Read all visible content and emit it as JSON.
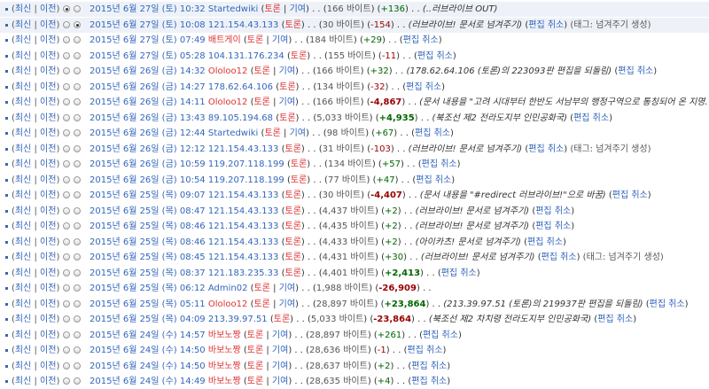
{
  "ui": {
    "cur": "최신",
    "prev": "이전",
    "undo": "편집 취소",
    "talk": "토론",
    "contribs": "기여",
    "bytes_unit": "바이트"
  },
  "rows": [
    {
      "date": "2015년 6월 27일 (토) 10:32",
      "user": "Startedwiki",
      "user_red": false,
      "contribs": true,
      "size": "166",
      "diff": "+136",
      "sign": "pos",
      "big": false,
      "comment": "(..러브라이브 OUT)",
      "undo": false,
      "tag": "",
      "sel": true,
      "r1": true,
      "r2": false
    },
    {
      "date": "2015년 6월 27일 (토) 10:08",
      "user": "121.154.43.133",
      "user_red": false,
      "contribs": false,
      "size": "30",
      "diff": "-154",
      "sign": "neg",
      "big": false,
      "comment": "(러브라이브! 문서로 넘겨주기)",
      "undo": true,
      "tag": "(태그: 넘겨주기 생성)",
      "sel": true,
      "r1": false,
      "r2": true
    },
    {
      "date": "2015년 6월 27일 (토) 07:49",
      "user": "배트게이",
      "user_red": true,
      "contribs": true,
      "size": "184",
      "diff": "+29",
      "sign": "pos",
      "big": false,
      "comment": "",
      "undo": true,
      "tag": "",
      "sel": false,
      "r1": false,
      "r2": false
    },
    {
      "date": "2015년 6월 27일 (토) 05:28",
      "user": "104.131.176.234",
      "user_red": false,
      "contribs": false,
      "size": "155",
      "diff": "-11",
      "sign": "neg",
      "big": false,
      "comment": "",
      "undo": true,
      "tag": "",
      "sel": false,
      "r1": false,
      "r2": false
    },
    {
      "date": "2015년 6월 26일 (금) 14:32",
      "user": "Ololoo12",
      "user_red": true,
      "contribs": true,
      "size": "166",
      "diff": "+32",
      "sign": "pos",
      "big": false,
      "comment": "(178.62.64.106 (토론)의 223093판 편집을 되돌림)",
      "undo": true,
      "tag": "",
      "sel": false,
      "r1": false,
      "r2": false
    },
    {
      "date": "2015년 6월 26일 (금) 14:27",
      "user": "178.62.64.106",
      "user_red": false,
      "contribs": false,
      "size": "134",
      "diff": "-32",
      "sign": "neg",
      "big": false,
      "comment": "",
      "undo": true,
      "tag": "",
      "sel": false,
      "r1": false,
      "r2": false
    },
    {
      "date": "2015년 6월 26일 (금) 14:11",
      "user": "Ololoo12",
      "user_red": true,
      "contribs": true,
      "size": "166",
      "diff": "-4,867",
      "sign": "neg",
      "big": true,
      "comment": "(문서 내용을 \"고려 시대부터 한반도 서남부의 행정구역으로 통칭되어 온 지명. 전라(全羅)",
      "undo": false,
      "tag": "",
      "sel": false,
      "r1": false,
      "r2": false
    },
    {
      "date": "2015년 6월 26일 (금) 13:43",
      "user": "89.105.194.68",
      "user_red": false,
      "contribs": false,
      "size": "5,033",
      "diff": "+4,935",
      "sign": "pos",
      "big": true,
      "comment": "(북조선 제2 전라도지부 인민공화국)",
      "undo": true,
      "tag": "",
      "sel": false,
      "r1": false,
      "r2": false
    },
    {
      "date": "2015년 6월 26일 (금) 12:44",
      "user": "Startedwiki",
      "user_red": false,
      "contribs": true,
      "size": "98",
      "diff": "+67",
      "sign": "pos",
      "big": false,
      "comment": "",
      "undo": true,
      "tag": "",
      "sel": false,
      "r1": false,
      "r2": false
    },
    {
      "date": "2015년 6월 26일 (금) 12:12",
      "user": "121.154.43.133",
      "user_red": false,
      "contribs": false,
      "size": "31",
      "diff": "-103",
      "sign": "neg",
      "big": false,
      "comment": "(러브라이브! 문서로 넘겨주기)",
      "undo": true,
      "tag": "(태그: 넘겨주기 생성)",
      "sel": false,
      "r1": false,
      "r2": false
    },
    {
      "date": "2015년 6월 26일 (금) 10:59",
      "user": "119.207.118.199",
      "user_red": false,
      "contribs": false,
      "size": "134",
      "diff": "+57",
      "sign": "pos",
      "big": false,
      "comment": "",
      "undo": true,
      "tag": "",
      "sel": false,
      "r1": false,
      "r2": false
    },
    {
      "date": "2015년 6월 26일 (금) 10:54",
      "user": "119.207.118.199",
      "user_red": false,
      "contribs": false,
      "size": "77",
      "diff": "+47",
      "sign": "pos",
      "big": false,
      "comment": "",
      "undo": true,
      "tag": "",
      "sel": false,
      "r1": false,
      "r2": false
    },
    {
      "date": "2015년 6월 25일 (목) 09:07",
      "user": "121.154.43.133",
      "user_red": false,
      "contribs": false,
      "size": "30",
      "diff": "-4,407",
      "sign": "neg",
      "big": true,
      "comment": "(문서 내용을 \"#redirect 러브라이브!\"으로 바꿈)",
      "undo": true,
      "tag": "",
      "sel": false,
      "r1": false,
      "r2": false
    },
    {
      "date": "2015년 6월 25일 (목) 08:47",
      "user": "121.154.43.133",
      "user_red": false,
      "contribs": false,
      "size": "4,437",
      "diff": "+2",
      "sign": "pos",
      "big": false,
      "comment": "(러브라이브! 문서로 넘겨주기)",
      "undo": true,
      "tag": "",
      "sel": false,
      "r1": false,
      "r2": false
    },
    {
      "date": "2015년 6월 25일 (목) 08:46",
      "user": "121.154.43.133",
      "user_red": false,
      "contribs": false,
      "size": "4,435",
      "diff": "+2",
      "sign": "pos",
      "big": false,
      "comment": "(러브라이브! 문서로 넘겨주기)",
      "undo": true,
      "tag": "",
      "sel": false,
      "r1": false,
      "r2": false
    },
    {
      "date": "2015년 6월 25일 (목) 08:46",
      "user": "121.154.43.133",
      "user_red": false,
      "contribs": false,
      "size": "4,433",
      "diff": "+2",
      "sign": "pos",
      "big": false,
      "comment": "(아이카츠! 문서로 넘겨주기)",
      "undo": true,
      "tag": "",
      "sel": false,
      "r1": false,
      "r2": false
    },
    {
      "date": "2015년 6월 25일 (목) 08:45",
      "user": "121.154.43.133",
      "user_red": false,
      "contribs": false,
      "size": "4,431",
      "diff": "+30",
      "sign": "pos",
      "big": false,
      "comment": "(러브라이브! 문서로 넘겨주기)",
      "undo": true,
      "tag": "(태그: 넘겨주기 생성)",
      "sel": false,
      "r1": false,
      "r2": false
    },
    {
      "date": "2015년 6월 25일 (목) 08:37",
      "user": "121.183.235.33",
      "user_red": false,
      "contribs": false,
      "size": "4,401",
      "diff": "+2,413",
      "sign": "pos",
      "big": true,
      "comment": "",
      "undo": true,
      "tag": "",
      "sel": false,
      "r1": false,
      "r2": false
    },
    {
      "date": "2015년 6월 25일 (목) 06:12",
      "user": "Admin02",
      "user_red": false,
      "contribs": true,
      "size": "1,988",
      "diff": "-26,909",
      "sign": "neg",
      "big": true,
      "comment": "",
      "undo": false,
      "tag": "",
      "sel": false,
      "r1": false,
      "r2": false
    },
    {
      "date": "2015년 6월 25일 (목) 05:11",
      "user": "Ololoo12",
      "user_red": true,
      "contribs": true,
      "size": "28,897",
      "diff": "+23,864",
      "sign": "pos",
      "big": true,
      "comment": "(213.39.97.51 (토론)의 219937판 편집을 되돌림)",
      "undo": true,
      "tag": "",
      "sel": false,
      "r1": false,
      "r2": false
    },
    {
      "date": "2015년 6월 25일 (목) 04:09",
      "user": "213.39.97.51",
      "user_red": false,
      "contribs": false,
      "size": "5,033",
      "diff": "-23,864",
      "sign": "neg",
      "big": true,
      "comment": "(북조선 제2 차치령 전라도지부 인민공화국)",
      "undo": true,
      "tag": "",
      "sel": false,
      "r1": false,
      "r2": false
    },
    {
      "date": "2015년 6월 24일 (수) 14:57",
      "user": "바보노짱",
      "user_red": true,
      "contribs": true,
      "size": "28,897",
      "diff": "+261",
      "sign": "pos",
      "big": false,
      "comment": "",
      "undo": true,
      "tag": "",
      "sel": false,
      "r1": false,
      "r2": false
    },
    {
      "date": "2015년 6월 24일 (수) 14:50",
      "user": "바보노짱",
      "user_red": true,
      "contribs": true,
      "size": "28,636",
      "diff": "-1",
      "sign": "neg",
      "big": false,
      "comment": "",
      "undo": true,
      "tag": "",
      "sel": false,
      "r1": false,
      "r2": false
    },
    {
      "date": "2015년 6월 24일 (수) 14:50",
      "user": "바보노짱",
      "user_red": true,
      "contribs": true,
      "size": "28,637",
      "diff": "+2",
      "sign": "pos",
      "big": false,
      "comment": "",
      "undo": true,
      "tag": "",
      "sel": false,
      "r1": false,
      "r2": false
    },
    {
      "date": "2015년 6월 24일 (수) 14:49",
      "user": "바보노짱",
      "user_red": true,
      "contribs": true,
      "size": "28,635",
      "diff": "+4",
      "sign": "pos",
      "big": false,
      "comment": "",
      "undo": true,
      "tag": "",
      "sel": false,
      "r1": false,
      "r2": false
    }
  ]
}
